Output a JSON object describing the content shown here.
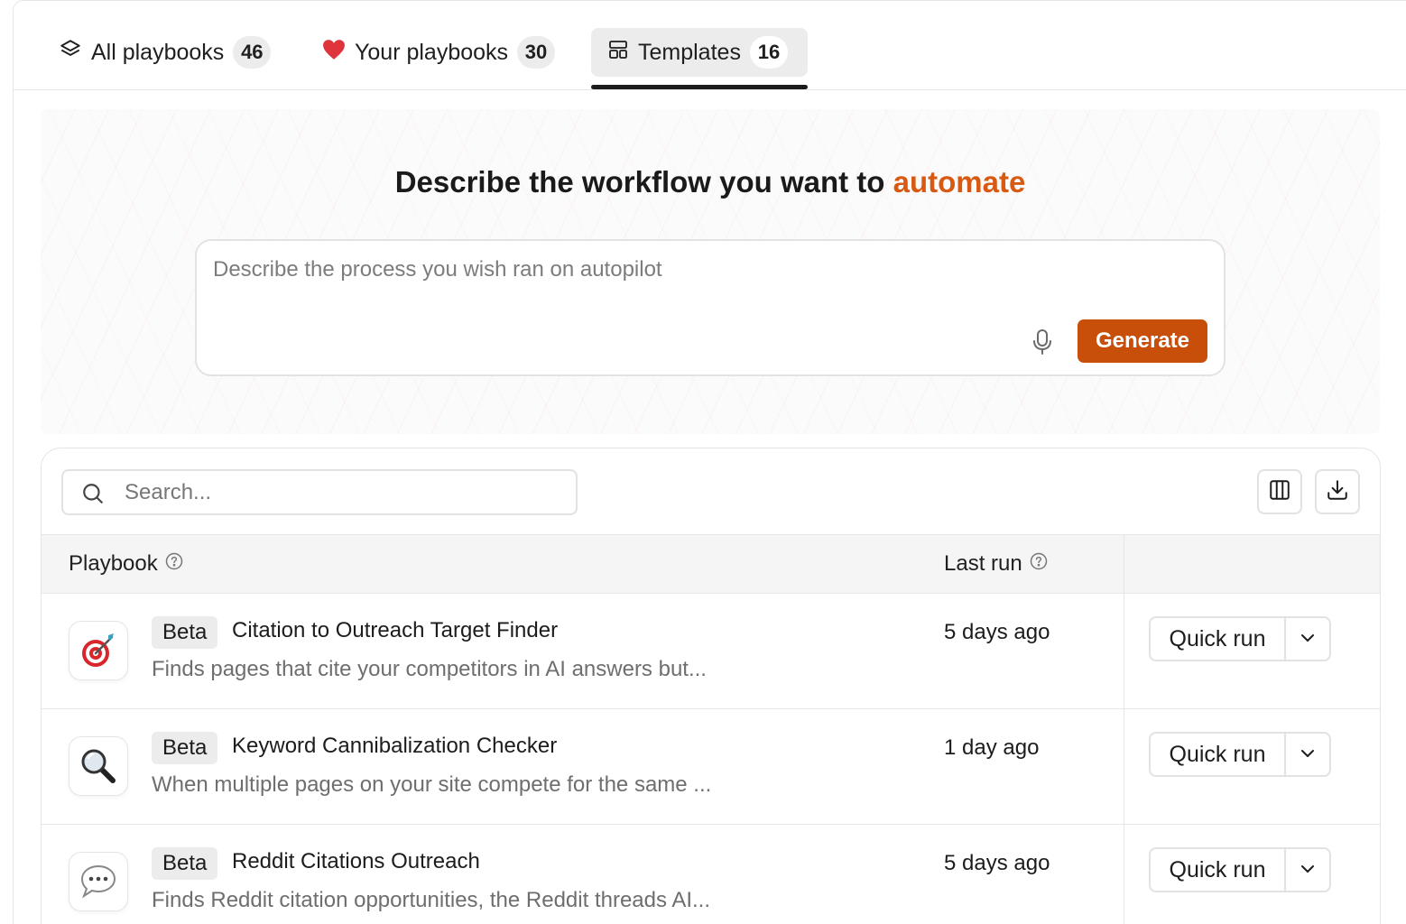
{
  "tabs": [
    {
      "label": "All playbooks",
      "count": "46",
      "icon": "layers-icon"
    },
    {
      "label": "Your playbooks",
      "count": "30",
      "icon": "heart-icon"
    },
    {
      "label": "Templates",
      "count": "16",
      "icon": "template-icon"
    }
  ],
  "active_tab": "Templates",
  "hero": {
    "title_prefix": "Describe the workflow you want to ",
    "title_accent": "automate",
    "placeholder": "Describe the process you wish ran on autopilot",
    "generate_label": "Generate"
  },
  "search": {
    "placeholder": "Search..."
  },
  "table": {
    "columns": {
      "playbook": "Playbook",
      "last_run": "Last run"
    },
    "rows": [
      {
        "icon": "🎯",
        "badge": "Beta",
        "title": "Citation to Outreach Target Finder",
        "description": "Finds pages that cite your competitors in AI answers but...",
        "last_run": "5 days ago",
        "action": "Quick run"
      },
      {
        "icon": "🔍",
        "badge": "Beta",
        "title": "Keyword Cannibalization Checker",
        "description": "When multiple pages on your site compete for the same ...",
        "last_run": "1 day ago",
        "action": "Quick run"
      },
      {
        "icon": "💬",
        "badge": "Beta",
        "title": "Reddit Citations Outreach",
        "description": "Finds Reddit citation opportunities, the Reddit threads AI...",
        "last_run": "5 days ago",
        "action": "Quick run"
      }
    ]
  },
  "colors": {
    "accent": "#d85a12",
    "button": "#c74f0a",
    "heart": "#e0343c"
  }
}
